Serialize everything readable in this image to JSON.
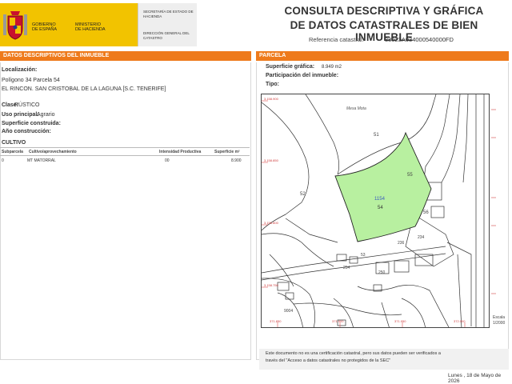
{
  "header": {
    "gov_left_1": "GOBIERNO",
    "gov_left_2": "DE ESPAÑA",
    "gov_right_1": "MINISTERIO",
    "gov_right_2": "DE HACIENDA",
    "secretaria": "SECRETARÍA DE ESTADO DE HACIENDA",
    "direccion": "DIRECCIÓN GENERAL DEL CATASTRO",
    "title_line1": "CONSULTA DESCRIPTIVA Y GRÁFICA",
    "title_line2": "DE DATOS CATASTRALES DE BIEN INMUEBLE",
    "ref_label": "Referencia catastral:",
    "ref_value": "38023A034000540000FD"
  },
  "left": {
    "bar": "DATOS DESCRIPTIVOS DEL INMUEBLE",
    "loc_label": "Localización:",
    "loc_line1": "Polígono 34 Parcela 54",
    "loc_line2": "EL RINCON. SAN CRISTOBAL DE LA LAGUNA [S.C. TENERIFE]",
    "clase_label": "Clase:",
    "clase_value": "RÚSTICO",
    "uso_label": "Uso principal:",
    "uso_value": "Agrario",
    "sup_label": "Superficie construida:",
    "anio_label": "Año construcción:",
    "cultivo_title": "CULTIVO",
    "table": {
      "headers": [
        "Subparcela",
        "Cultivo/aprovechamiento",
        "Intensidad Productiva",
        "Superficie m²"
      ],
      "row": [
        "0",
        "MT MATORRAL",
        "00",
        "8.900"
      ]
    }
  },
  "right": {
    "bar": "PARCELA",
    "sup_grafica_label": "Superficie gráfica:",
    "sup_grafica_value": "8.949 m2",
    "participacion_label": "Participación del inmueble:",
    "tipo_label": "Tipo:",
    "map": {
      "parcel_ref": "1154",
      "parcel_num": "54",
      "place": "Mesa Mota",
      "labels": [
        "51",
        "52",
        "55",
        "56",
        "53",
        "236",
        "234",
        "250",
        "254",
        "9004"
      ],
      "coords": [
        "3.158.900",
        "3.158.850",
        "3.158.800",
        "3.158.750",
        "371.850",
        "371.900",
        "371.950",
        "372.000",
        "372.100"
      ],
      "scale_label": "Escala",
      "scale_value": "1/2000"
    },
    "notice_line1": "Este documento no es una certificación catastral, pero sus datos pueden ser verificados a",
    "notice_line2": "través del \"Acceso a datos catastrales no protegidos de la SEC\"",
    "date": "Lunes , 18 de Mayo de 2026"
  },
  "colors": {
    "accent": "#ee7a1b",
    "gov_yellow": "#f2c300",
    "parcel_green": "#b8f0a0"
  }
}
